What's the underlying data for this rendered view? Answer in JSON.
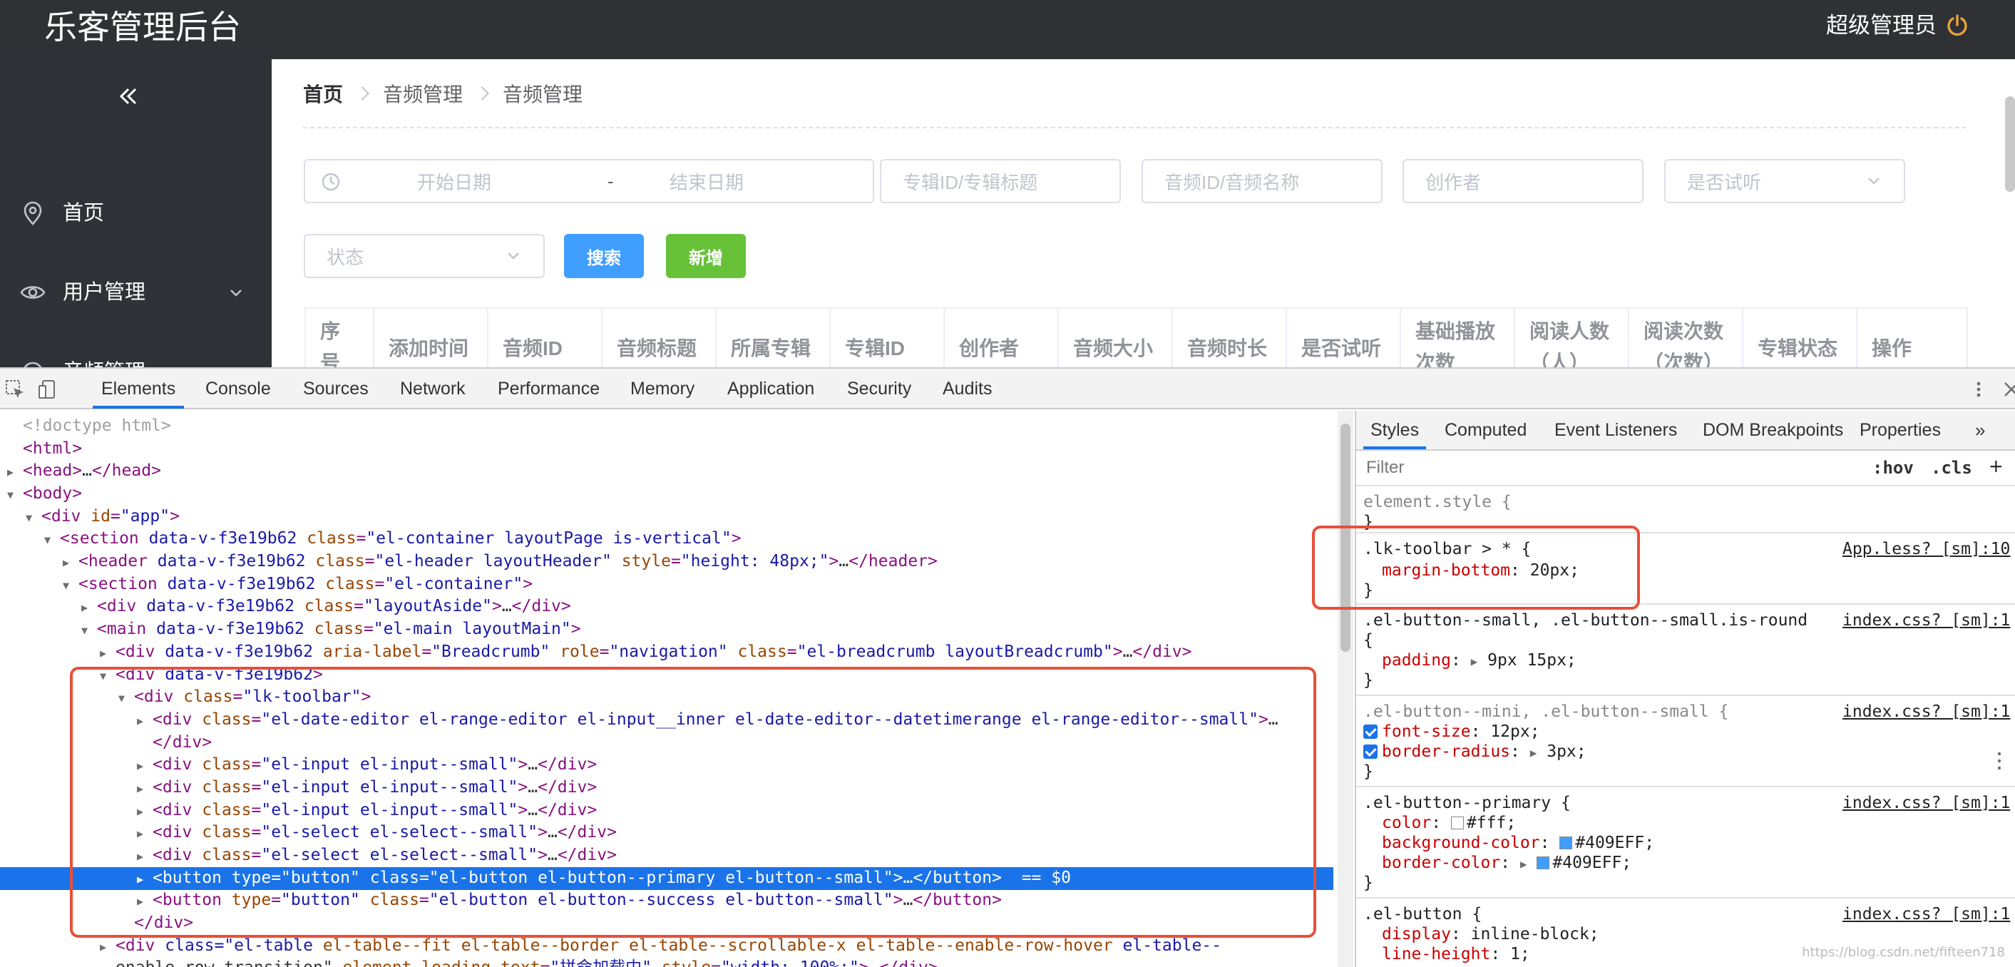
{
  "app": {
    "title": "乐客管理后台",
    "admin_label": "超级管理员",
    "accent": "#e6a23c",
    "sidebar": {
      "items": [
        {
          "label": "首页",
          "icon": "location-icon"
        },
        {
          "label": "用户管理",
          "icon": "eye-icon",
          "arrow": "chevron-down-icon"
        },
        {
          "label": "音频管理",
          "icon": "headphone-icon",
          "arrow": "chevron-up-icon"
        }
      ]
    },
    "breadcrumb": [
      "首页",
      "音频管理",
      "音频管理"
    ],
    "filters": {
      "start_date": "开始日期",
      "range_sep": "-",
      "end_date": "结束日期",
      "album": "专辑ID/专辑标题",
      "audio": "音频ID/音频名称",
      "creator": "创作者",
      "trial": "是否试听",
      "status": "状态"
    },
    "buttons": {
      "search": "搜索",
      "add": "新增",
      "search_color": "#409eff",
      "add_color": "#67c23a"
    },
    "table_headers": [
      "序号",
      "添加时间",
      "音频ID",
      "音频标题",
      "所属专辑",
      "专辑ID",
      "创作者",
      "音频大小",
      "音频时长",
      "是否试听",
      "基础播放次数",
      "阅读人数（人）",
      "阅读次数（次数）",
      "专辑状态",
      "操作"
    ]
  },
  "devtools": {
    "tabs": [
      "Elements",
      "Console",
      "Sources",
      "Network",
      "Performance",
      "Memory",
      "Application",
      "Security",
      "Audits"
    ],
    "elements": [
      {
        "depth": 0,
        "html": "<!doctype html>"
      },
      {
        "depth": 0,
        "html": "<html>"
      },
      {
        "depth": 0,
        "html": "<head>…</head>"
      },
      {
        "depth": 0,
        "html": "<body>"
      },
      {
        "depth": 1,
        "html": "<div id=\"app\">"
      },
      {
        "depth": 2,
        "html": "<section data-v-f3e19b62 class=\"el-container layoutPage is-vertical\">"
      },
      {
        "depth": 3,
        "html": "<header data-v-f3e19b62 class=\"el-header layoutHeader\" style=\"height: 48px;\">…</header>"
      },
      {
        "depth": 3,
        "html": "<section data-v-f3e19b62 class=\"el-container\">"
      },
      {
        "depth": 4,
        "html": "<div data-v-f3e19b62 class=\"layoutAside\">…</div>"
      },
      {
        "depth": 4,
        "html": "<main data-v-f3e19b62 class=\"el-main layoutMain\">"
      },
      {
        "depth": 5,
        "html": "<div data-v-f3e19b62 aria-label=\"Breadcrumb\" role=\"navigation\" class=\"el-breadcrumb layoutBreadcrumb\">…</div>"
      },
      {
        "depth": 5,
        "html": "<div data-v-f3e19b62>"
      },
      {
        "depth": 6,
        "html": "<div class=\"lk-toolbar\">"
      },
      {
        "depth": 7,
        "html": "<div class=\"el-date-editor el-range-editor el-input__inner el-date-editor--datetimerange el-range-editor--small\">…"
      },
      {
        "depth": 7,
        "html": "</div>"
      },
      {
        "depth": 7,
        "html": "<div class=\"el-input el-input--small\">…</div>"
      },
      {
        "depth": 7,
        "html": "<div class=\"el-input el-input--small\">…</div>"
      },
      {
        "depth": 7,
        "html": "<div class=\"el-input el-input--small\">…</div>"
      },
      {
        "depth": 7,
        "html": "<div class=\"el-select el-select--small\">…</div>"
      },
      {
        "depth": 7,
        "html": "<div class=\"el-select el-select--small\">…</div>"
      },
      {
        "depth": 7,
        "html": "<button type=\"button\" class=\"el-button el-button--primary el-button--small\">…</button> == $0"
      },
      {
        "depth": 7,
        "html": "<button type=\"button\" class=\"el-button el-button--success el-button--small\">…</button>"
      },
      {
        "depth": 6,
        "html": "</div>"
      },
      {
        "depth": 5,
        "html": "<div class=\"el-table el-table--fit el-table--border el-table--scrollable-x el-table--enable-row-hover el-table--"
      },
      {
        "depth": 5,
        "html": "enable-row-transition\" element-loading-text=\"拼命加载中\" style=\"width: 100%;\">…</div>"
      }
    ],
    "styles_tabs": [
      "Styles",
      "Computed",
      "Event Listeners",
      "DOM Breakpoints",
      "Properties"
    ],
    "filter_placeholder": "Filter",
    "hov": ":hov",
    "cls": ".cls",
    "rules": [
      {
        "selector": "element.style {",
        "source": "",
        "props": [],
        "close": "}"
      },
      {
        "selector": ".lk-toolbar > * {",
        "source": "App.less? [sm]:10",
        "props": [
          {
            "n": "margin-bottom",
            "v": "20px;"
          }
        ],
        "close": "}"
      },
      {
        "selector": ".el-button--small, .el-button--small.is-round",
        "source": "index.css? [sm]:1",
        "props": [
          {
            "n": "padding",
            "v": "9px 15px;"
          }
        ],
        "open": "{",
        "close": "}"
      },
      {
        "selector": ".el-button--mini, .el-button--small {",
        "source": "index.css? [sm]:1",
        "props": [
          {
            "n": "font-size",
            "v": "12px;"
          },
          {
            "n": "border-radius",
            "v": "3px;"
          }
        ],
        "close": "}"
      },
      {
        "selector": ".el-button--primary {",
        "source": "index.css? [sm]:1",
        "props": [
          {
            "n": "color",
            "v": "#fff;"
          },
          {
            "n": "background-color",
            "v": "#409EFF;"
          },
          {
            "n": "border-color",
            "v": "#409EFF;"
          }
        ],
        "close": "}"
      },
      {
        "selector": ".el-button {",
        "source": "index.css? [sm]:1",
        "props": [
          {
            "n": "display",
            "v": "inline-block;"
          },
          {
            "n": "line-height",
            "v": "1;"
          }
        ]
      }
    ],
    "watermark": "https://blog.csdn.net/fifteen718"
  }
}
